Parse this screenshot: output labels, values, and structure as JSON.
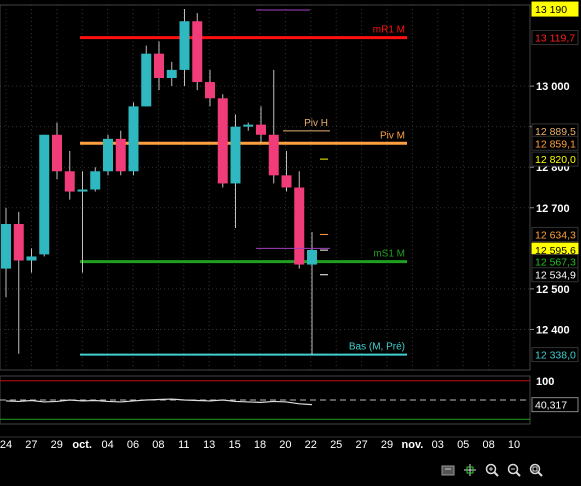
{
  "chart_data": {
    "type": "candlestick",
    "price_axis": {
      "ylim": [
        12300,
        13200
      ],
      "ticks": [
        {
          "value": 13000,
          "label": "13 000"
        },
        {
          "value": 12900,
          "label": ""
        },
        {
          "value": 12800,
          "label": "12 800"
        },
        {
          "value": 12700,
          "label": "12 700"
        },
        {
          "value": 12500,
          "label": "12 500"
        },
        {
          "value": 12400,
          "label": "12 400"
        }
      ]
    },
    "price_tags": [
      {
        "value": 13190,
        "label": "13 190",
        "bg": "#ffff00",
        "fg": "#000000"
      },
      {
        "value": 13119.7,
        "label": "13 119,7",
        "bg": "#000000",
        "fg": "#ff2020"
      },
      {
        "value": 12889.5,
        "label": "12 889,5",
        "bg": "#000000",
        "fg": "#e8b070"
      },
      {
        "value": 12859.1,
        "label": "12 859,1",
        "bg": "#000000",
        "fg": "#ffa040"
      },
      {
        "value": 12820,
        "label": "12 820,0",
        "bg": "#000000",
        "fg": "#ffff00"
      },
      {
        "value": 12634.3,
        "label": "12 634,3",
        "bg": "#000000",
        "fg": "#ffa040"
      },
      {
        "value": 12595.6,
        "label": "12 595,6",
        "bg": "#ffff00",
        "fg": "#000000"
      },
      {
        "value": 12567.3,
        "label": "12 567,3",
        "bg": "#000000",
        "fg": "#20c020"
      },
      {
        "value": 12534.9,
        "label": "12 534,9",
        "bg": "#000000",
        "fg": "#ffffff"
      },
      {
        "value": 12338,
        "label": "12 338,0",
        "bg": "#000000",
        "fg": "#40d0d0"
      }
    ],
    "levels": [
      {
        "name": "mR1 M",
        "value": 13119.7,
        "color": "#ff1010",
        "width": 3,
        "x_start": 80
      },
      {
        "name": "Piv H",
        "value": 12889.5,
        "color": "#e8b070",
        "width": 1,
        "x_start": 283,
        "x_end": 330
      },
      {
        "name": "Piv M",
        "value": 12859.1,
        "color": "#ffa040",
        "width": 3,
        "x_start": 80
      },
      {
        "name": "mS1 M",
        "value": 12567.3,
        "color": "#20a020",
        "width": 3,
        "x_start": 80
      },
      {
        "name": "Bas (M, Pré)",
        "value": 12338,
        "color": "#40d0d0",
        "width": 2,
        "x_start": 80
      }
    ],
    "candles": [
      {
        "x": "2023-09-25",
        "open": 12550,
        "high": 12700,
        "low": 12480,
        "close": 12660
      },
      {
        "x": "2023-09-26",
        "open": 12660,
        "high": 12690,
        "low": 12340,
        "close": 12570
      },
      {
        "x": "2023-09-27",
        "open": 12570,
        "high": 12600,
        "low": 12540,
        "close": 12580
      },
      {
        "x": "2023-09-28",
        "open": 12585,
        "high": 12880,
        "low": 12580,
        "close": 12880
      },
      {
        "x": "2023-09-29",
        "open": 12880,
        "high": 12910,
        "low": 12770,
        "close": 12790
      },
      {
        "x": "2023-10-02",
        "open": 12790,
        "high": 12840,
        "low": 12720,
        "close": 12740
      },
      {
        "x": "2023-10-03",
        "open": 12740,
        "high": 12790,
        "low": 12540,
        "close": 12745
      },
      {
        "x": "2023-10-04",
        "open": 12745,
        "high": 12800,
        "low": 12740,
        "close": 12790
      },
      {
        "x": "2023-10-05",
        "open": 12790,
        "high": 12880,
        "low": 12780,
        "close": 12870
      },
      {
        "x": "2023-10-06",
        "open": 12870,
        "high": 12890,
        "low": 12780,
        "close": 12790
      },
      {
        "x": "2023-10-09",
        "open": 12790,
        "high": 12960,
        "low": 12780,
        "close": 12950
      },
      {
        "x": "2023-10-10",
        "open": 12950,
        "high": 13100,
        "low": 12950,
        "close": 13080
      },
      {
        "x": "2023-10-11",
        "open": 13080,
        "high": 13110,
        "low": 12990,
        "close": 13020
      },
      {
        "x": "2023-10-12",
        "open": 13020,
        "high": 13060,
        "low": 13000,
        "close": 13040
      },
      {
        "x": "2023-10-13",
        "open": 13040,
        "high": 13190,
        "low": 13000,
        "close": 13160
      },
      {
        "x": "2023-10-16",
        "open": 13160,
        "high": 13180,
        "low": 12990,
        "close": 13010
      },
      {
        "x": "2023-10-17",
        "open": 13010,
        "high": 13040,
        "low": 12950,
        "close": 12970
      },
      {
        "x": "2023-10-18",
        "open": 12970,
        "high": 12980,
        "low": 12750,
        "close": 12760
      },
      {
        "x": "2023-10-19",
        "open": 12760,
        "high": 12930,
        "low": 12650,
        "close": 12900
      },
      {
        "x": "2023-10-20",
        "open": 12900,
        "high": 12910,
        "low": 12890,
        "close": 12905
      },
      {
        "x": "2023-10-23",
        "open": 12905,
        "high": 12950,
        "low": 12860,
        "close": 12880
      },
      {
        "x": "2023-10-24",
        "open": 12880,
        "high": 13040,
        "low": 12760,
        "close": 12780
      },
      {
        "x": "2023-10-25",
        "open": 12780,
        "high": 12840,
        "low": 12740,
        "close": 12750
      },
      {
        "x": "2023-10-26",
        "open": 12750,
        "high": 12790,
        "low": 12550,
        "close": 12560
      },
      {
        "x": "2023-10-27",
        "open": 12560,
        "high": 12640,
        "low": 12338,
        "close": 12596
      }
    ],
    "date_axis": {
      "ticks": [
        "24",
        "27",
        "29",
        "oct.",
        "04",
        "06",
        "08",
        "11",
        "13",
        "15",
        "18",
        "20",
        "22",
        "25",
        "27",
        "29",
        "nov.",
        "03",
        "05",
        "08",
        "10"
      ]
    },
    "oscillator": {
      "ylim": [
        0,
        100
      ],
      "upper_level": 90,
      "mid_level": 50,
      "lower_level": 10,
      "last_value_label": "40,317",
      "top_label": "100",
      "values": [
        48,
        47,
        49,
        46,
        47,
        50,
        48,
        49,
        47,
        46,
        48,
        50,
        51,
        52,
        50,
        49,
        48,
        50,
        47,
        46,
        45,
        47,
        46,
        42,
        40.317
      ]
    },
    "colors": {
      "background": "#000000",
      "grid": "#333333",
      "up_candle": "#30b8c0",
      "down_candle": "#f03c78",
      "wick": "#c0c0c0",
      "axis_text": "#ffffff"
    }
  },
  "toolbar": {
    "icons": [
      "chart-type-icon",
      "crosshair-icon",
      "zoom-in-icon",
      "zoom-out-icon",
      "zoom-fit-icon"
    ]
  }
}
